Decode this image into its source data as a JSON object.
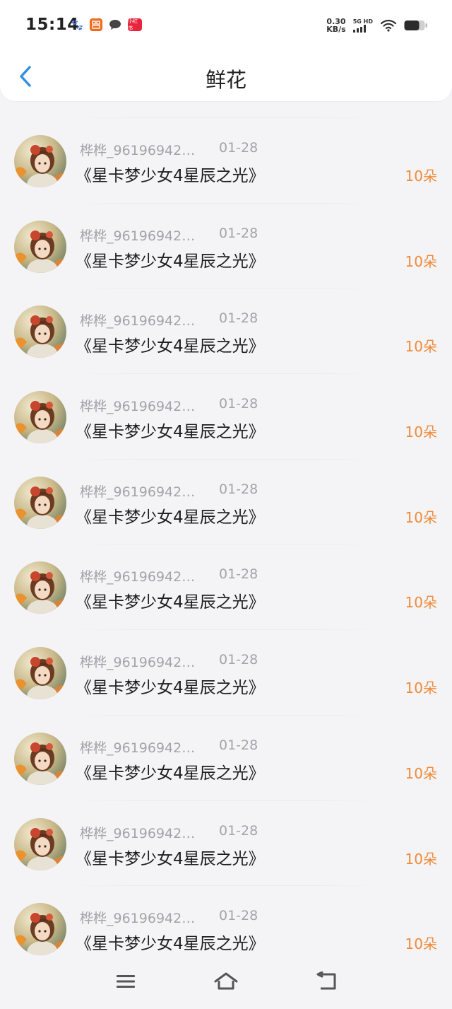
{
  "status_bar": {
    "time": "15:14",
    "net_speed_value": "0.30",
    "net_speed_unit": "KB/s",
    "network_type": "5G HD",
    "app_icons": [
      "baidu-paw-icon",
      "app-orange-icon",
      "chat-bubble-icon",
      "app-red-icon"
    ],
    "app2_label": "小红书"
  },
  "header": {
    "title": "鲜花",
    "back_icon": "chevron-left-icon",
    "accent_color": "#2f8ee0"
  },
  "list": {
    "items": [
      {
        "name": "桦桦_96196942…",
        "date": "01-28",
        "title": "《星卡梦少女4星辰之光》",
        "amount": "10朵"
      },
      {
        "name": "桦桦_96196942…",
        "date": "01-28",
        "title": "《星卡梦少女4星辰之光》",
        "amount": "10朵"
      },
      {
        "name": "桦桦_96196942…",
        "date": "01-28",
        "title": "《星卡梦少女4星辰之光》",
        "amount": "10朵"
      },
      {
        "name": "桦桦_96196942…",
        "date": "01-28",
        "title": "《星卡梦少女4星辰之光》",
        "amount": "10朵"
      },
      {
        "name": "桦桦_96196942…",
        "date": "01-28",
        "title": "《星卡梦少女4星辰之光》",
        "amount": "10朵"
      },
      {
        "name": "桦桦_96196942…",
        "date": "01-28",
        "title": "《星卡梦少女4星辰之光》",
        "amount": "10朵"
      },
      {
        "name": "桦桦_96196942…",
        "date": "01-28",
        "title": "《星卡梦少女4星辰之光》",
        "amount": "10朵"
      },
      {
        "name": "桦桦_96196942…",
        "date": "01-28",
        "title": "《星卡梦少女4星辰之光》",
        "amount": "10朵"
      },
      {
        "name": "桦桦_96196942…",
        "date": "01-28",
        "title": "《星卡梦少女4星辰之光》",
        "amount": "10朵"
      },
      {
        "name": "桦桦_96196942…",
        "date": "01-28",
        "title": "《星卡梦少女4星辰之光》",
        "amount": "10朵"
      }
    ],
    "amount_color": "#f08a3a"
  },
  "system_nav": {
    "menu_icon": "menu-icon",
    "home_icon": "home-icon",
    "back_icon": "back-arrow-icon"
  }
}
